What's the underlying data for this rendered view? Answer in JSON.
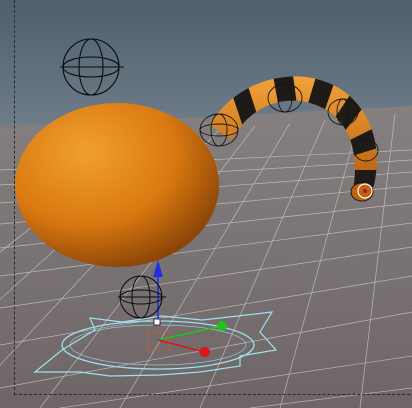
{
  "viewport": {
    "label": "3D viewport",
    "colors": {
      "sky": "#5e6e7c",
      "floor": "#7d7576",
      "grid": "#c9c6c6",
      "orange": "#e07a10",
      "stripe": "#1e1a17",
      "gizmo": "#9ee0ef",
      "axis_x": "#e0141a",
      "axis_y": "#22c21c",
      "axis_z": "#1c2ee0"
    },
    "objects": [
      {
        "name": "egg-object",
        "kind": "orange ellipsoid"
      },
      {
        "name": "snake-tube-object",
        "kind": "striped curved tube"
      },
      {
        "name": "light-helper",
        "kind": "wire sphere helper"
      },
      {
        "name": "transform-gizmo",
        "kind": "move/rotate manipulator"
      }
    ]
  }
}
